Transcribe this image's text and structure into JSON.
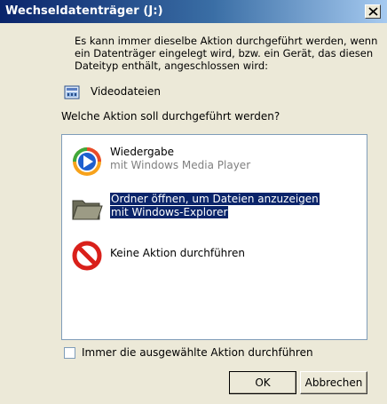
{
  "window": {
    "title": "Wechseldatenträger (J:)"
  },
  "info": {
    "line1": "Es kann immer dieselbe Aktion durchgeführt werden, wenn",
    "line2": "ein Datenträger eingelegt wird, bzw. ein Gerät, das diesen",
    "line3": "Dateityp enthält, angeschlossen wird:",
    "file_type": "Videodateien",
    "file_type_icon": "video-file-icon"
  },
  "question": "Welche Aktion soll durchgeführt werden?",
  "actions": [
    {
      "main": "Wiedergabe",
      "sub": "mit Windows Media Player",
      "icon": "media-player-icon",
      "selected": false
    },
    {
      "main": "Ordner öffnen, um Dateien anzuzeigen",
      "sub": "mit Windows-Explorer",
      "icon": "folder-icon",
      "selected": true
    },
    {
      "main": "Keine Aktion durchführen",
      "sub": "",
      "icon": "no-action-icon",
      "selected": false
    }
  ],
  "checkbox": {
    "label": "Immer die ausgewählte Aktion durchführen",
    "checked": false
  },
  "buttons": {
    "ok": "OK",
    "cancel": "Abbrechen"
  },
  "colors": {
    "title_gradient_start": "#0a246a",
    "title_gradient_end": "#a6caf0",
    "selection": "#0a246a",
    "dialog_bg": "#ece9d8"
  }
}
